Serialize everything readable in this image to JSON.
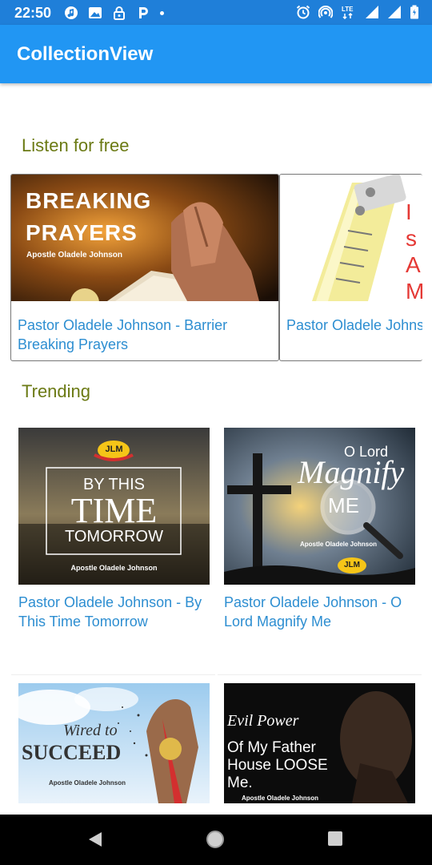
{
  "status_bar": {
    "time": "22:50",
    "left_icons": [
      "music-app-icon",
      "image-notification-icon",
      "lock-icon",
      "p-app-icon",
      "dot-icon"
    ],
    "right_icons": [
      "alarm-icon",
      "hotspot-icon",
      "lte-icon",
      "signal-icon",
      "signal-icon",
      "battery-icon"
    ],
    "lte_label": "LTE"
  },
  "app_bar": {
    "title": "CollectionView"
  },
  "sections": {
    "listen": {
      "title": "Listen for free"
    },
    "trending": {
      "title": "Trending"
    }
  },
  "listen_cards": [
    {
      "caption": "Pastor Oladele Johnson - Barrier Breaking Prayers",
      "art_line1": "BREAKING",
      "art_line2": "PRAYERS",
      "art_sub": "Apostle Oladele Johnson"
    },
    {
      "caption": "Pastor Oladele Johnson - I Shall Attain & Measure Up",
      "art_letters": [
        "I s",
        "A",
        "M"
      ]
    }
  ],
  "trending_cards": [
    {
      "caption": "Pastor Oladele Johnson - By This Time Tomorrow",
      "art_logo": "JLM",
      "art_line1": "BY THIS",
      "art_line2": "TIME",
      "art_line3": "TOMORROW",
      "art_sub": "Apostle Oladele Johnson"
    },
    {
      "caption": "Pastor Oladele Johnson - O Lord Magnify Me",
      "art_line1": "O Lord",
      "art_line2": "Magnify",
      "art_line3": "ME",
      "art_sub": "Apostle Oladele Johnson",
      "art_logo": "JLM"
    },
    {
      "caption": "",
      "art_line1": "Wired to",
      "art_line2": "SUCCEED",
      "art_sub": "Apostle Oladele Johnson"
    },
    {
      "caption": "",
      "art_line1": "Evil Power",
      "art_line2": "Of My Father",
      "art_line3": "House LOOSE",
      "art_line4": "Me.",
      "art_sub": "Apostle Oladele Johnson"
    }
  ],
  "nav_bar": {
    "buttons": [
      "back-icon",
      "home-icon",
      "recents-icon"
    ]
  },
  "colors": {
    "status_bar": "#1f7fd9",
    "app_bar": "#2196f3",
    "section_title": "#6b7a14",
    "caption": "#2d8ed1"
  }
}
